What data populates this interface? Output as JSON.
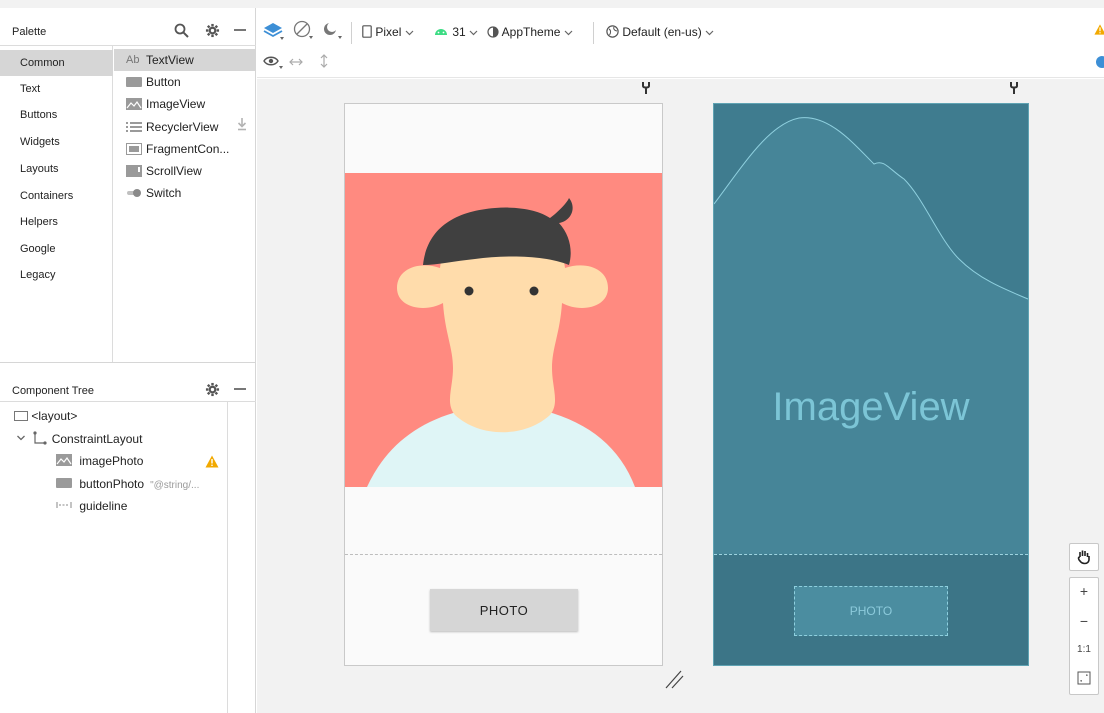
{
  "palette": {
    "title": "Palette",
    "categories": [
      "Common",
      "Text",
      "Buttons",
      "Widgets",
      "Layouts",
      "Containers",
      "Helpers",
      "Google",
      "Legacy"
    ],
    "items": [
      {
        "icon": "Ab",
        "label": "TextView"
      },
      {
        "icon": "button-icon",
        "label": "Button"
      },
      {
        "icon": "image-icon",
        "label": "ImageView"
      },
      {
        "icon": "list-icon",
        "label": "RecyclerView"
      },
      {
        "icon": "fragment-icon",
        "label": "FragmentCon..."
      },
      {
        "icon": "scroll-icon",
        "label": "ScrollView"
      },
      {
        "icon": "switch-icon",
        "label": "Switch"
      }
    ]
  },
  "component_tree": {
    "title": "Component Tree",
    "nodes": [
      {
        "label": "<layout>"
      },
      {
        "label": "ConstraintLayout"
      },
      {
        "label": "imagePhoto"
      },
      {
        "label": "buttonPhoto",
        "hint": "\"@string/..."
      },
      {
        "label": "guideline"
      }
    ]
  },
  "toolbar": {
    "device": "Pixel",
    "api": "31",
    "theme": "AppTheme",
    "locale": "Default (en-us)"
  },
  "design": {
    "button_label": "PHOTO"
  },
  "blueprint": {
    "image_label": "ImageView",
    "button_label": "PHOTO"
  },
  "zoom": {
    "plus": "+",
    "minus": "−",
    "one_to_one": "1:1"
  },
  "colors": {
    "photo_bg": "#ff8a80",
    "blueprint_bg": "#468598",
    "warning": "#f2a900"
  }
}
